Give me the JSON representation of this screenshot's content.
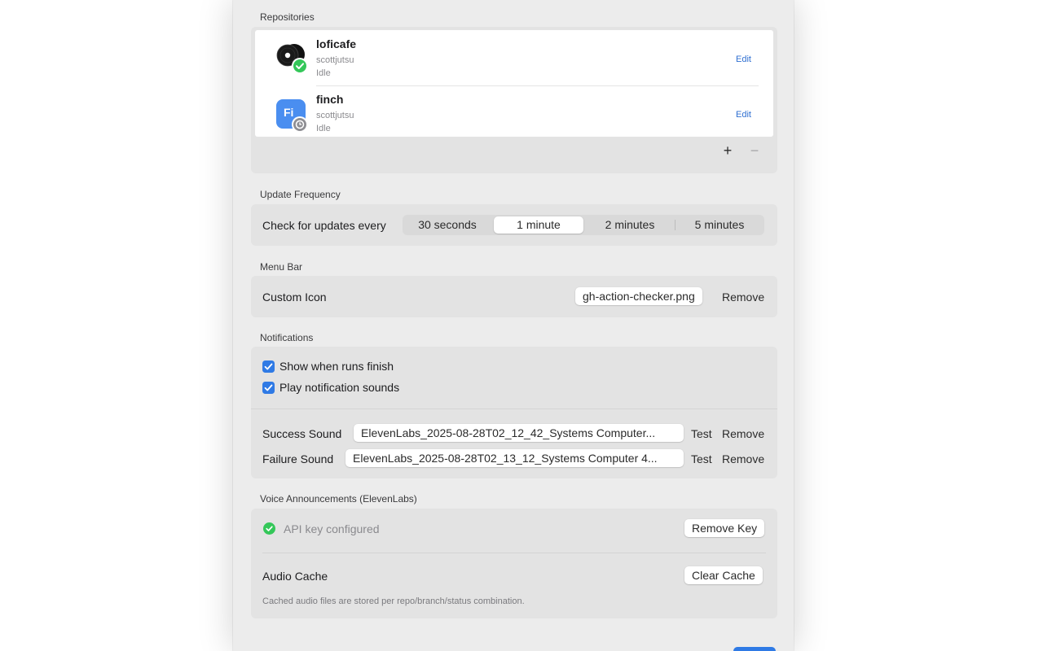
{
  "sections": {
    "repositories": "Repositories",
    "update_frequency": "Update Frequency",
    "menu_bar": "Menu Bar",
    "notifications": "Notifications",
    "voice": "Voice Announcements (ElevenLabs)"
  },
  "repositories": [
    {
      "name": "loficafe",
      "owner": "scottjutsu",
      "status": "Idle",
      "edit_label": "Edit",
      "icon": "vinyl-records-icon",
      "badge": "success-check-badge"
    },
    {
      "name": "finch",
      "owner": "scottjutsu",
      "status": "Idle",
      "edit_label": "Edit",
      "icon": "finch-app-icon",
      "badge": "pending-clock-badge",
      "icon_text": "Fi"
    }
  ],
  "repo_controls": {
    "add": "+",
    "remove": "−"
  },
  "update_frequency": {
    "label": "Check for updates every",
    "options": [
      "30 seconds",
      "1 minute",
      "2 minutes",
      "5 minutes"
    ],
    "selected": "1 minute"
  },
  "menu_bar": {
    "label": "Custom Icon",
    "file": "gh-action-checker.png",
    "remove_label": "Remove"
  },
  "notifications": {
    "show_finish": {
      "label": "Show when runs finish",
      "checked": true
    },
    "play_sounds": {
      "label": "Play notification sounds",
      "checked": true
    },
    "success": {
      "label": "Success Sound",
      "file": "ElevenLabs_2025-08-28T02_12_42_Systems Computer...",
      "test": "Test",
      "remove": "Remove"
    },
    "failure": {
      "label": "Failure Sound",
      "file": "ElevenLabs_2025-08-28T02_13_12_Systems Computer 4...",
      "test": "Test",
      "remove": "Remove"
    }
  },
  "voice": {
    "api_status": "API key configured",
    "remove_key": "Remove Key",
    "cache_label": "Audio Cache",
    "clear_cache": "Clear Cache",
    "cache_hint": "Cached audio files are stored per repo/branch/status combination."
  },
  "colors": {
    "accent": "#2f7ae5",
    "success": "#34c759",
    "link": "#2f6fd1"
  }
}
